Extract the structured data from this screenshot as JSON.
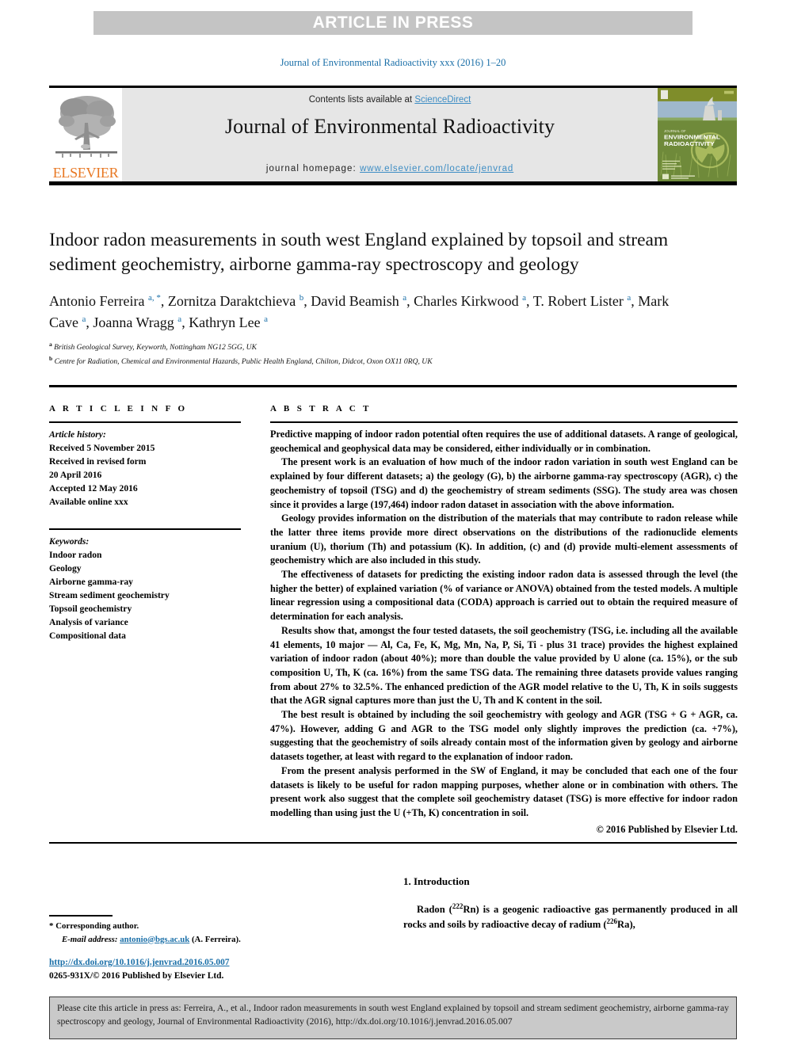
{
  "banner": {
    "label": "ARTICLE IN PRESS"
  },
  "running_head": "Journal of Environmental Radioactivity xxx (2016) 1–20",
  "masthead": {
    "publisher_name": "ELSEVIER",
    "publisher_logo_icon": "elsevier-tree-logo",
    "contents_prefix": "Contents lists available at ",
    "contents_link": "ScienceDirect",
    "journal_title": "Journal of Environmental Radioactivity",
    "homepage_prefix": "journal homepage: ",
    "homepage_url": "www.elsevier.com/locate/jenvrad",
    "cover": {
      "line1": "JOURNAL OF",
      "line2": "ENVIRONMENTAL",
      "line3": "RADIOACTIVITY",
      "icon": "journal-cover-thumbnail"
    },
    "accent_link_color": "#3d8dc4",
    "elsevier_orange": "#e87722"
  },
  "article": {
    "title": "Indoor radon measurements in south west England explained by topsoil and stream sediment geochemistry, airborne gamma-ray spectroscopy and geology",
    "authors": [
      {
        "name": "Antonio Ferreira",
        "marks": "a,",
        "star": "*",
        "sep": ", "
      },
      {
        "name": "Zornitza Daraktchieva",
        "marks": "b",
        "star": "",
        "sep": ", "
      },
      {
        "name": "David Beamish",
        "marks": "a",
        "star": "",
        "sep": ", "
      },
      {
        "name": "Charles Kirkwood",
        "marks": "a",
        "star": "",
        "sep": ", "
      },
      {
        "name": "T. Robert Lister",
        "marks": "a",
        "star": "",
        "sep": ", "
      },
      {
        "name": "Mark Cave",
        "marks": "a",
        "star": "",
        "sep": ", "
      },
      {
        "name": "Joanna Wragg",
        "marks": "a",
        "star": "",
        "sep": ", "
      },
      {
        "name": "Kathryn Lee",
        "marks": "a",
        "star": "",
        "sep": ""
      }
    ],
    "affiliations": [
      {
        "mark": "a",
        "text": "British Geological Survey, Keyworth, Nottingham NG12 5GG, UK"
      },
      {
        "mark": "b",
        "text": "Centre for Radiation, Chemical and Environmental Hazards, Public Health England, Chilton, Didcot, Oxon OX11 0RQ, UK"
      }
    ]
  },
  "article_info": {
    "heading": "A R T I C L E  I N F O",
    "history_label": "Article history:",
    "history_lines": [
      "Received 5 November 2015",
      "Received in revised form",
      "20 April 2016",
      "Accepted 12 May 2016",
      "Available online xxx"
    ],
    "keywords_label": "Keywords:",
    "keywords": [
      "Indoor radon",
      "Geology",
      "Airborne gamma-ray",
      "Stream sediment geochemistry",
      "Topsoil geochemistry",
      "Analysis of variance",
      "Compositional data"
    ]
  },
  "abstract": {
    "heading": "A B S T R A C T",
    "paragraphs": [
      "Predictive mapping of indoor radon potential often requires the use of additional datasets. A range of geological, geochemical and geophysical data may be considered, either individually or in combination.",
      "The present work is an evaluation of how much of the indoor radon variation in south west England can be explained by four different datasets; a) the geology (G), b) the airborne gamma-ray spectroscopy (AGR), c) the geochemistry of topsoil (TSG) and d) the geochemistry of stream sediments (SSG). The study area was chosen since it provides a large (197,464) indoor radon dataset in association with the above information.",
      "Geology provides information on the distribution of the materials that may contribute to radon release while the latter three items provide more direct observations on the distributions of the radionuclide elements uranium (U), thorium (Th) and potassium (K). In addition, (c) and (d) provide multi-element assessments of geochemistry which are also included in this study.",
      "The effectiveness of datasets for predicting the existing indoor radon data is assessed through the level (the higher the better) of explained variation (% of variance or ANOVA) obtained from the tested models. A multiple linear regression using a compositional data (CODA) approach is carried out to obtain the required measure of determination for each analysis.",
      "Results show that, amongst the four tested datasets, the soil geochemistry (TSG, i.e. including all the available 41 elements, 10 major — Al, Ca, Fe, K, Mg, Mn, Na, P, Si, Ti - plus 31 trace) provides the highest explained variation of indoor radon (about 40%); more than double the value provided by U alone (ca. 15%), or the sub composition U, Th, K (ca. 16%) from the same TSG data. The remaining three datasets provide values ranging from about 27% to 32.5%. The enhanced prediction of the AGR model relative to the U, Th, K in soils suggests that the AGR signal captures more than just the U, Th and K content in the soil.",
      "The best result is obtained by including the soil geochemistry with geology and AGR (TSG + G + AGR, ca. 47%). However, adding G and AGR to the TSG model only slightly improves the prediction (ca. +7%), suggesting that the geochemistry of soils already contain most of the information given by geology and airborne datasets together, at least with regard to the explanation of indoor radon.",
      "From the present analysis performed in the SW of England, it may be concluded that each one of the four datasets is likely to be useful for radon mapping purposes, whether alone or in combination with others. The present work also suggest that the complete soil geochemistry dataset (TSG) is more effective for indoor radon modelling than using just the U (+Th, K) concentration in soil."
    ],
    "copyright": "© 2016 Published by Elsevier Ltd."
  },
  "body": {
    "intro_heading": "1. Introduction",
    "intro_text_1": "Radon (",
    "intro_sup_1": "222",
    "intro_text_2": "Rn) is a geogenic radioactive gas permanently produced in all rocks and soils by radioactive decay of radium (",
    "intro_sup_2": "226",
    "intro_text_3": "Ra),"
  },
  "footnote": {
    "star": "*",
    "corresponding": "Corresponding author.",
    "email_label": "E-mail address:",
    "email": "antonio@bgs.ac.uk",
    "email_suffix": "(A. Ferreira).",
    "doi_url": "http://dx.doi.org/10.1016/j.jenvrad.2016.05.007",
    "issn_line": "0265-931X/© 2016 Published by Elsevier Ltd."
  },
  "cite_box": {
    "text": "Please cite this article in press as: Ferreira, A., et al., Indoor radon measurements in south west England explained by topsoil and stream sediment geochemistry, airborne gamma-ray spectroscopy and geology, Journal of Environmental Radioactivity (2016), http://dx.doi.org/10.1016/j.jenvrad.2016.05.007"
  }
}
